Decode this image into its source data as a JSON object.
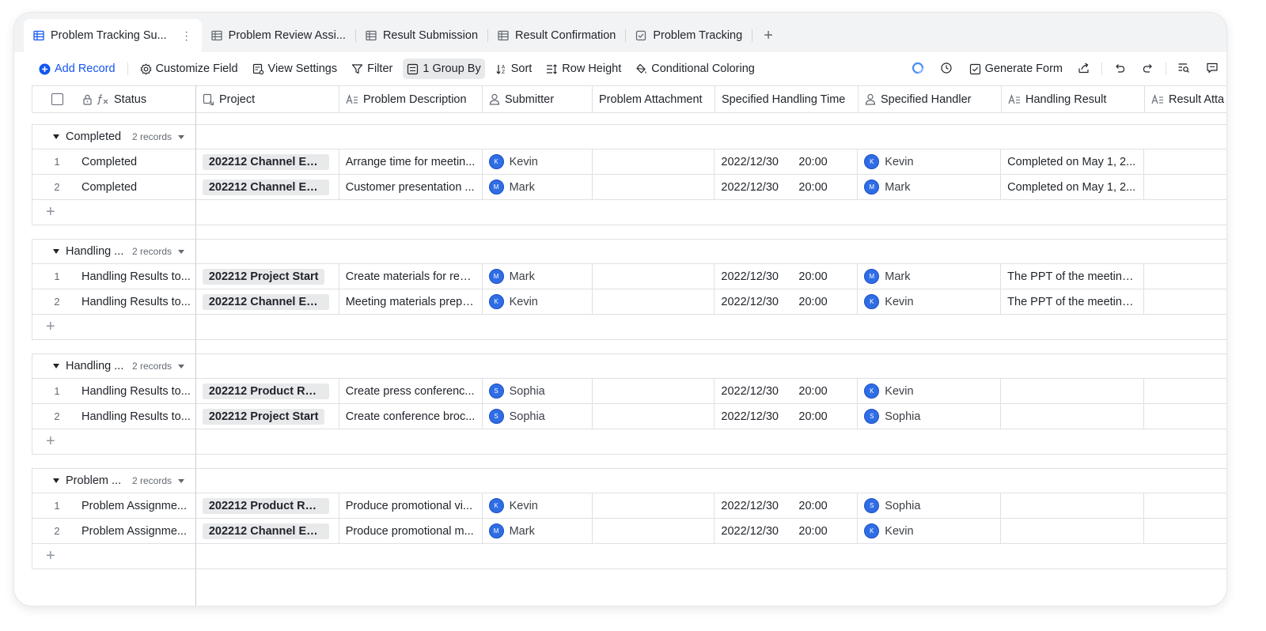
{
  "tabs": [
    {
      "label": "Problem Tracking Su...",
      "active": true,
      "icon": "grid-table-icon"
    },
    {
      "label": "Problem Review Assi...",
      "icon": "grid-table-icon"
    },
    {
      "label": "Result Submission",
      "icon": "grid-table-icon"
    },
    {
      "label": "Result Confirmation",
      "icon": "grid-table-icon"
    },
    {
      "label": "Problem Tracking",
      "icon": "form-checkbox-icon"
    }
  ],
  "toolbar": {
    "add_record": "Add Record",
    "customize_field": "Customize Field",
    "view_settings": "View Settings",
    "filter": "Filter",
    "group_by": "1 Group By",
    "sort": "Sort",
    "row_height": "Row Height",
    "conditional_coloring": "Conditional Coloring",
    "generate_form": "Generate Form",
    "accent": "#1456f0"
  },
  "columns": {
    "status": "Status",
    "project": "Project",
    "problem_description": "Problem Description",
    "submitter": "Submitter",
    "problem_attachment": "Problem Attachment",
    "specified_handling_time": "Specified Handling Time",
    "specified_handler": "Specified Handler",
    "handling_result": "Handling Result",
    "result_attachment": "Result Atta"
  },
  "groups": [
    {
      "name": "Completed",
      "count": "2 records",
      "rows": [
        {
          "num": "1",
          "status": "Completed",
          "project": "202212 Channel Exp...",
          "desc": "Arrange time for meetin...",
          "submitter": "Kevin",
          "sub_init": "K",
          "date": "2022/12/30",
          "time": "20:00",
          "handler": "Kevin",
          "hand_init": "K",
          "result": "Completed on May 1, 2..."
        },
        {
          "num": "2",
          "status": "Completed",
          "project": "202212 Channel Exp...",
          "desc": "Customer presentation ...",
          "submitter": "Mark",
          "sub_init": "M",
          "date": "2022/12/30",
          "time": "20:00",
          "handler": "Mark",
          "hand_init": "M",
          "result": "Completed on May 1, 2..."
        }
      ]
    },
    {
      "name": "Handling ...",
      "count": "2 records",
      "rows": [
        {
          "num": "1",
          "status": "Handling Results to...",
          "project": "202212 Project Start",
          "desc": "Create materials for regi...",
          "submitter": "Mark",
          "sub_init": "M",
          "date": "2022/12/30",
          "time": "20:00",
          "handler": "Mark",
          "hand_init": "M",
          "result": "The PPT of the meeting ..."
        },
        {
          "num": "2",
          "status": "Handling Results to...",
          "project": "202212 Channel Exp...",
          "desc": "Meeting materials prepa...",
          "submitter": "Kevin",
          "sub_init": "K",
          "date": "2022/12/30",
          "time": "20:00",
          "handler": "Kevin",
          "hand_init": "K",
          "result": "The PPT of the meeting ..."
        }
      ]
    },
    {
      "name": "Handling ...",
      "count": "2 records",
      "rows": [
        {
          "num": "1",
          "status": "Handling Results to...",
          "project": "202212 Product Rele...",
          "desc": "Create press conferenc...",
          "submitter": "Sophia",
          "sub_init": "S",
          "date": "2022/12/30",
          "time": "20:00",
          "handler": "Kevin",
          "hand_init": "K",
          "result": ""
        },
        {
          "num": "2",
          "status": "Handling Results to...",
          "project": "202212 Project Start",
          "desc": "Create conference broc...",
          "submitter": "Sophia",
          "sub_init": "S",
          "date": "2022/12/30",
          "time": "20:00",
          "handler": "Sophia",
          "hand_init": "S",
          "result": ""
        }
      ]
    },
    {
      "name": "Problem ...",
      "count": "2 records",
      "rows": [
        {
          "num": "1",
          "status": "Problem Assignme...",
          "project": "202212 Product Rele...",
          "desc": "Produce promotional vi...",
          "submitter": "Kevin",
          "sub_init": "K",
          "date": "2022/12/30",
          "time": "20:00",
          "handler": "Sophia",
          "hand_init": "S",
          "result": ""
        },
        {
          "num": "2",
          "status": "Problem Assignme...",
          "project": "202212 Channel Exp...",
          "desc": "Produce promotional m...",
          "submitter": "Mark",
          "sub_init": "M",
          "date": "2022/12/30",
          "time": "20:00",
          "handler": "Kevin",
          "hand_init": "K",
          "result": ""
        }
      ]
    }
  ]
}
